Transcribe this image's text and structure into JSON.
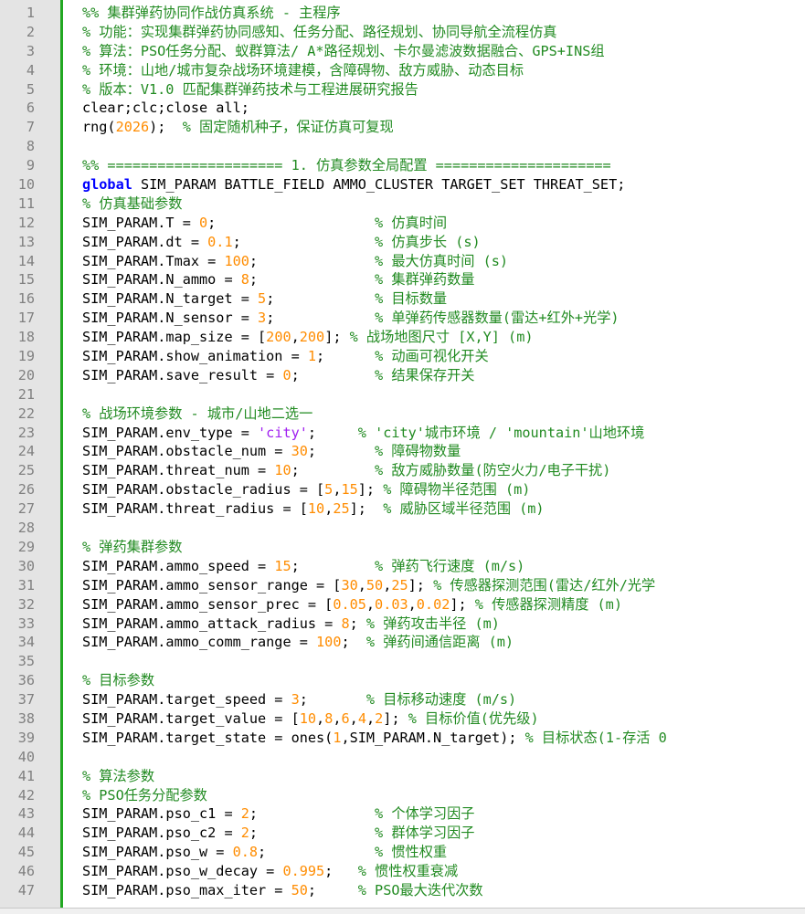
{
  "editor": {
    "colors": {
      "comment": "#228b22",
      "keyword": "#0000ff",
      "number": "#ff8c00",
      "string": "#a020f0",
      "fold_bar": "#22a822",
      "gutter": "#e4e4e4"
    },
    "lines": [
      [
        [
          "cm",
          "%% 集群弹药协同作战仿真系统 - 主程序"
        ]
      ],
      [
        [
          "cm",
          "% 功能：实现集群弹药协同感知、任务分配、路径规划、协同导航全流程仿真"
        ]
      ],
      [
        [
          "cm",
          "% 算法：PSO任务分配、蚁群算法/ A*路径规划、卡尔曼滤波数据融合、GPS+INS组"
        ]
      ],
      [
        [
          "cm",
          "% 环境：山地/城市复杂战场环境建模，含障碍物、敌方威胁、动态目标"
        ]
      ],
      [
        [
          "cm",
          "% 版本：V1.0 匹配集群弹药技术与工程进展研究报告"
        ]
      ],
      [
        [
          "t",
          "clear;clc;close all;"
        ]
      ],
      [
        [
          "t",
          "rng("
        ],
        [
          "num",
          "2026"
        ],
        [
          "t",
          ");  "
        ],
        [
          "cm",
          "% 固定随机种子，保证仿真可复现"
        ]
      ],
      [],
      [
        [
          "cm",
          "%% ===================== 1. 仿真参数全局配置 ====================="
        ]
      ],
      [
        [
          "kw",
          "global"
        ],
        [
          "t",
          " SIM_PARAM BATTLE_FIELD AMMO_CLUSTER TARGET_SET THREAT_SET;"
        ]
      ],
      [
        [
          "cm",
          "% 仿真基础参数"
        ]
      ],
      [
        [
          "t",
          "SIM_PARAM.T = "
        ],
        [
          "num",
          "0"
        ],
        [
          "t",
          ";                   "
        ],
        [
          "cm",
          "% 仿真时间"
        ]
      ],
      [
        [
          "t",
          "SIM_PARAM.dt = "
        ],
        [
          "num",
          "0.1"
        ],
        [
          "t",
          ";                "
        ],
        [
          "cm",
          "% 仿真步长 (s)"
        ]
      ],
      [
        [
          "t",
          "SIM_PARAM.Tmax = "
        ],
        [
          "num",
          "100"
        ],
        [
          "t",
          ";              "
        ],
        [
          "cm",
          "% 最大仿真时间 (s)"
        ]
      ],
      [
        [
          "t",
          "SIM_PARAM.N_ammo = "
        ],
        [
          "num",
          "8"
        ],
        [
          "t",
          ";              "
        ],
        [
          "cm",
          "% 集群弹药数量"
        ]
      ],
      [
        [
          "t",
          "SIM_PARAM.N_target = "
        ],
        [
          "num",
          "5"
        ],
        [
          "t",
          ";            "
        ],
        [
          "cm",
          "% 目标数量"
        ]
      ],
      [
        [
          "t",
          "SIM_PARAM.N_sensor = "
        ],
        [
          "num",
          "3"
        ],
        [
          "t",
          ";            "
        ],
        [
          "cm",
          "% 单弹药传感器数量(雷达+红外+光学)"
        ]
      ],
      [
        [
          "t",
          "SIM_PARAM.map_size = ["
        ],
        [
          "num",
          "200"
        ],
        [
          "t",
          ","
        ],
        [
          "num",
          "200"
        ],
        [
          "t",
          "]; "
        ],
        [
          "cm",
          "% 战场地图尺寸 [X,Y] (m)"
        ]
      ],
      [
        [
          "t",
          "SIM_PARAM.show_animation = "
        ],
        [
          "num",
          "1"
        ],
        [
          "t",
          ";      "
        ],
        [
          "cm",
          "% 动画可视化开关"
        ]
      ],
      [
        [
          "t",
          "SIM_PARAM.save_result = "
        ],
        [
          "num",
          "0"
        ],
        [
          "t",
          ";         "
        ],
        [
          "cm",
          "% 结果保存开关"
        ]
      ],
      [],
      [
        [
          "cm",
          "% 战场环境参数 - 城市/山地二选一"
        ]
      ],
      [
        [
          "t",
          "SIM_PARAM.env_type = "
        ],
        [
          "str",
          "'city'"
        ],
        [
          "t",
          ";     "
        ],
        [
          "cm",
          "% 'city'城市环境 / 'mountain'山地环境"
        ]
      ],
      [
        [
          "t",
          "SIM_PARAM.obstacle_num = "
        ],
        [
          "num",
          "30"
        ],
        [
          "t",
          ";       "
        ],
        [
          "cm",
          "% 障碍物数量"
        ]
      ],
      [
        [
          "t",
          "SIM_PARAM.threat_num = "
        ],
        [
          "num",
          "10"
        ],
        [
          "t",
          ";         "
        ],
        [
          "cm",
          "% 敌方威胁数量(防空火力/电子干扰)"
        ]
      ],
      [
        [
          "t",
          "SIM_PARAM.obstacle_radius = ["
        ],
        [
          "num",
          "5"
        ],
        [
          "t",
          ","
        ],
        [
          "num",
          "15"
        ],
        [
          "t",
          "]; "
        ],
        [
          "cm",
          "% 障碍物半径范围 (m)"
        ]
      ],
      [
        [
          "t",
          "SIM_PARAM.threat_radius = ["
        ],
        [
          "num",
          "10"
        ],
        [
          "t",
          ","
        ],
        [
          "num",
          "25"
        ],
        [
          "t",
          "];  "
        ],
        [
          "cm",
          "% 威胁区域半径范围 (m)"
        ]
      ],
      [],
      [
        [
          "cm",
          "% 弹药集群参数"
        ]
      ],
      [
        [
          "t",
          "SIM_PARAM.ammo_speed = "
        ],
        [
          "num",
          "15"
        ],
        [
          "t",
          ";         "
        ],
        [
          "cm",
          "% 弹药飞行速度 (m/s)"
        ]
      ],
      [
        [
          "t",
          "SIM_PARAM.ammo_sensor_range = ["
        ],
        [
          "num",
          "30"
        ],
        [
          "t",
          ","
        ],
        [
          "num",
          "50"
        ],
        [
          "t",
          ","
        ],
        [
          "num",
          "25"
        ],
        [
          "t",
          "]; "
        ],
        [
          "cm",
          "% 传感器探测范围(雷达/红外/光学"
        ]
      ],
      [
        [
          "t",
          "SIM_PARAM.ammo_sensor_prec = ["
        ],
        [
          "num",
          "0.05"
        ],
        [
          "t",
          ","
        ],
        [
          "num",
          "0.03"
        ],
        [
          "t",
          ","
        ],
        [
          "num",
          "0.02"
        ],
        [
          "t",
          "]; "
        ],
        [
          "cm",
          "% 传感器探测精度 (m)"
        ]
      ],
      [
        [
          "t",
          "SIM_PARAM.ammo_attack_radius = "
        ],
        [
          "num",
          "8"
        ],
        [
          "t",
          "; "
        ],
        [
          "cm",
          "% 弹药攻击半径 (m)"
        ]
      ],
      [
        [
          "t",
          "SIM_PARAM.ammo_comm_range = "
        ],
        [
          "num",
          "100"
        ],
        [
          "t",
          ";  "
        ],
        [
          "cm",
          "% 弹药间通信距离 (m)"
        ]
      ],
      [],
      [
        [
          "cm",
          "% 目标参数"
        ]
      ],
      [
        [
          "t",
          "SIM_PARAM.target_speed = "
        ],
        [
          "num",
          "3"
        ],
        [
          "t",
          ";       "
        ],
        [
          "cm",
          "% 目标移动速度 (m/s)"
        ]
      ],
      [
        [
          "t",
          "SIM_PARAM.target_value = ["
        ],
        [
          "num",
          "10"
        ],
        [
          "t",
          ","
        ],
        [
          "num",
          "8"
        ],
        [
          "t",
          ","
        ],
        [
          "num",
          "6"
        ],
        [
          "t",
          ","
        ],
        [
          "num",
          "4"
        ],
        [
          "t",
          ","
        ],
        [
          "num",
          "2"
        ],
        [
          "t",
          "]; "
        ],
        [
          "cm",
          "% 目标价值(优先级)"
        ]
      ],
      [
        [
          "t",
          "SIM_PARAM.target_state = ones("
        ],
        [
          "num",
          "1"
        ],
        [
          "t",
          ",SIM_PARAM.N_target); "
        ],
        [
          "cm",
          "% 目标状态(1-存活 0"
        ]
      ],
      [],
      [
        [
          "cm",
          "% 算法参数"
        ]
      ],
      [
        [
          "cm",
          "% PSO任务分配参数"
        ]
      ],
      [
        [
          "t",
          "SIM_PARAM.pso_c1 = "
        ],
        [
          "num",
          "2"
        ],
        [
          "t",
          ";              "
        ],
        [
          "cm",
          "% 个体学习因子"
        ]
      ],
      [
        [
          "t",
          "SIM_PARAM.pso_c2 = "
        ],
        [
          "num",
          "2"
        ],
        [
          "t",
          ";              "
        ],
        [
          "cm",
          "% 群体学习因子"
        ]
      ],
      [
        [
          "t",
          "SIM_PARAM.pso_w = "
        ],
        [
          "num",
          "0.8"
        ],
        [
          "t",
          ";             "
        ],
        [
          "cm",
          "% 惯性权重"
        ]
      ],
      [
        [
          "t",
          "SIM_PARAM.pso_w_decay = "
        ],
        [
          "num",
          "0.995"
        ],
        [
          "t",
          ";   "
        ],
        [
          "cm",
          "% 惯性权重衰减"
        ]
      ],
      [
        [
          "t",
          "SIM_PARAM.pso_max_iter = "
        ],
        [
          "num",
          "50"
        ],
        [
          "t",
          ";     "
        ],
        [
          "cm",
          "% PSO最大迭代次数"
        ]
      ]
    ]
  }
}
